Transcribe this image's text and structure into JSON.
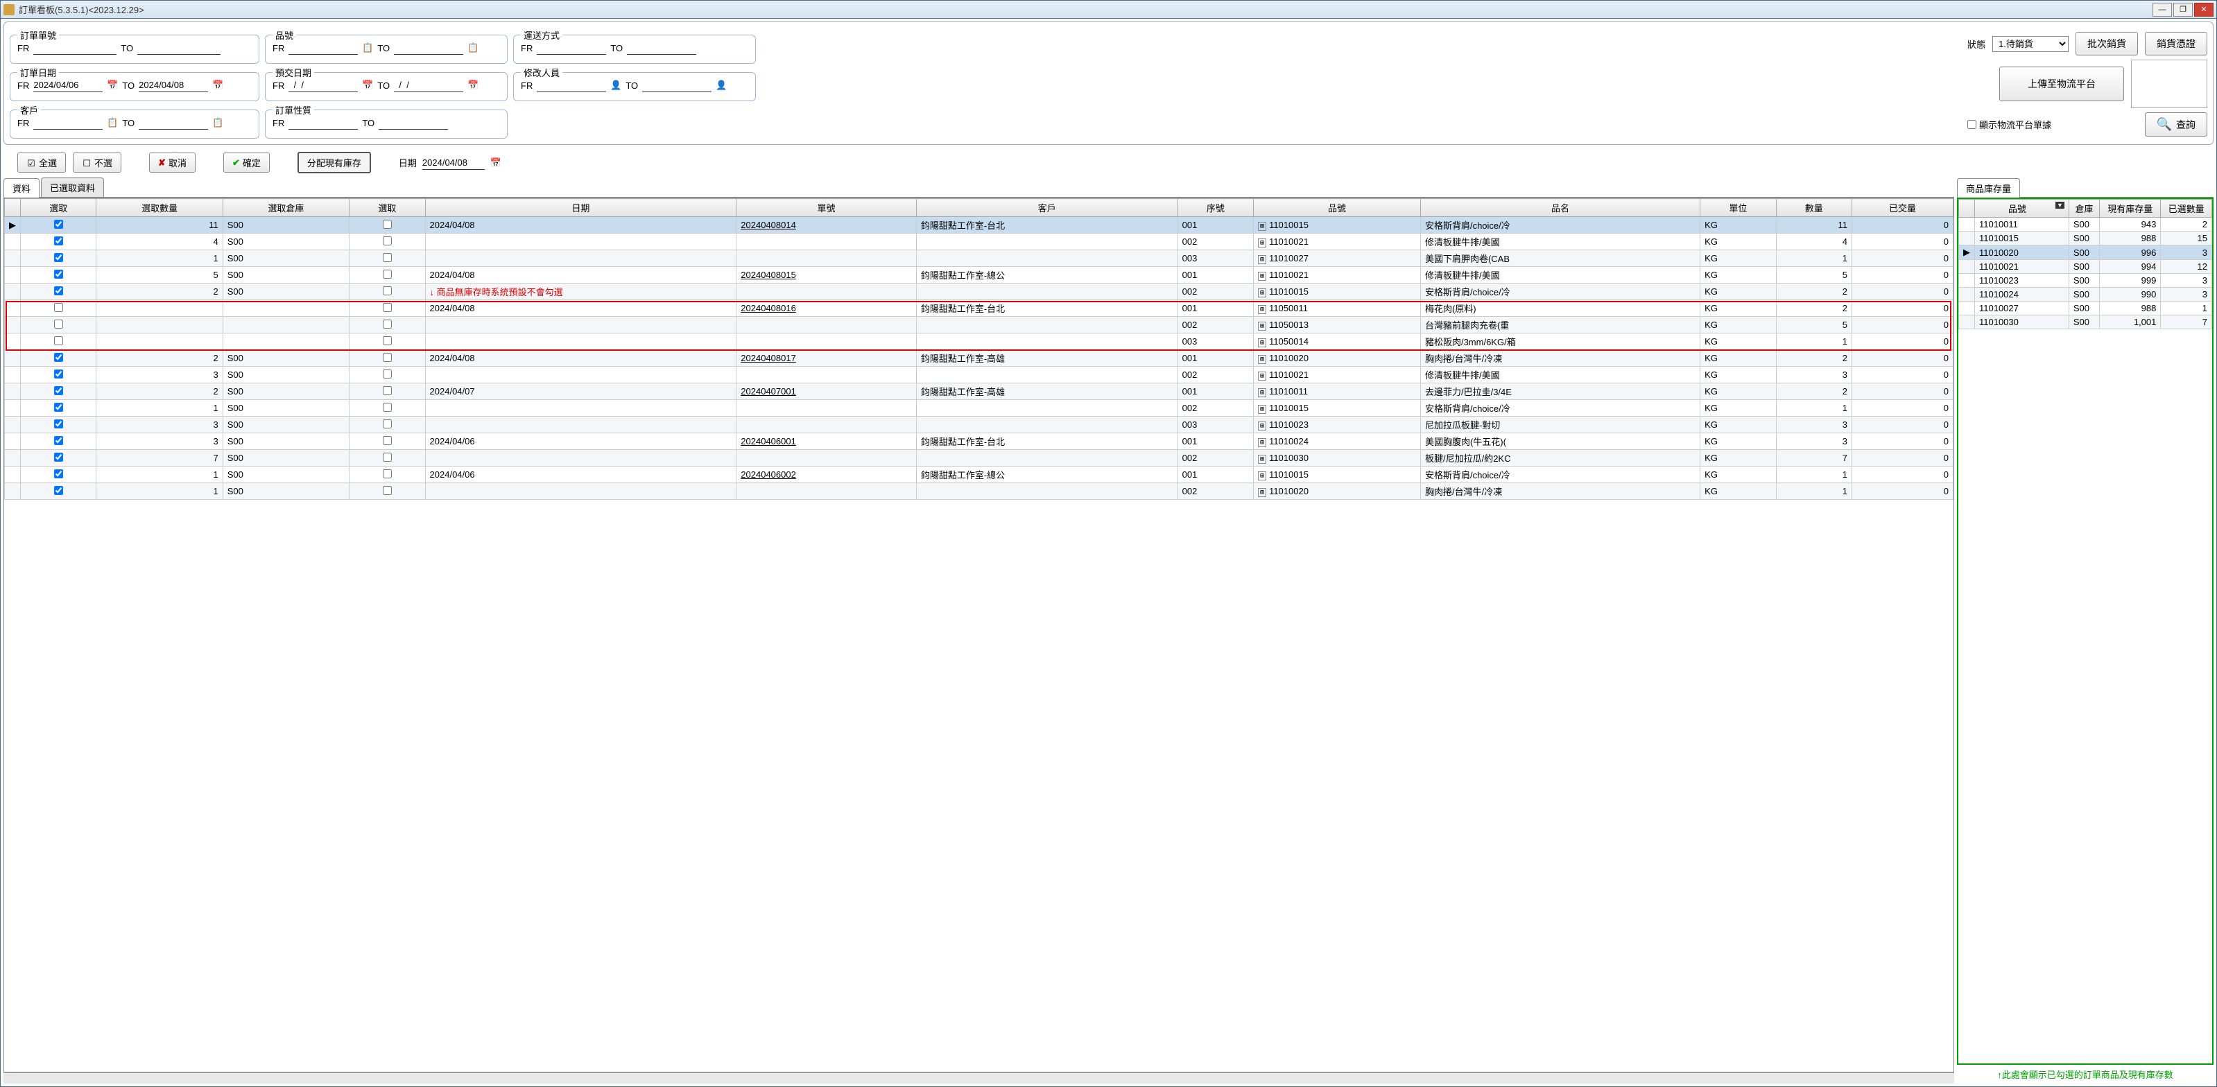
{
  "window": {
    "title": "訂單看板(5.3.5.1)<2023.12.29>"
  },
  "filters": {
    "order_no": {
      "legend": "訂單單號",
      "fr_label": "FR",
      "fr": "",
      "to_label": "TO",
      "to": ""
    },
    "product_no": {
      "legend": "品號",
      "fr_label": "FR",
      "fr": "",
      "to_label": "TO",
      "to": ""
    },
    "ship_method": {
      "legend": "運送方式",
      "fr_label": "FR",
      "fr": "",
      "to_label": "TO",
      "to": ""
    },
    "order_date": {
      "legend": "訂單日期",
      "fr_label": "FR",
      "fr": "2024/04/06",
      "to_label": "TO",
      "to": "2024/04/08"
    },
    "due_date": {
      "legend": "預交日期",
      "fr_label": "FR",
      "fr": "  /  /",
      "to_label": "TO",
      "to": "  /  /"
    },
    "modifier": {
      "legend": "修改人員",
      "fr_label": "FR",
      "fr": "",
      "to_label": "TO",
      "to": ""
    },
    "customer": {
      "legend": "客戶",
      "fr_label": "FR",
      "fr": "",
      "to_label": "TO",
      "to": ""
    },
    "order_type": {
      "legend": "訂單性質",
      "fr_label": "FR",
      "fr": "",
      "to_label": "TO",
      "to": ""
    }
  },
  "right_controls": {
    "status_label": "狀態",
    "status_value": "1.待銷貨",
    "batch_sale": "批次銷貨",
    "sale_voucher": "銷貨憑證",
    "upload_logistics": "上傳至物流平台",
    "show_logistics_label": "顯示物流平台單據",
    "search": "查詢"
  },
  "toolbar": {
    "select_all": "全選",
    "select_none": "不選",
    "cancel": "取消",
    "confirm": "確定",
    "alloc_stock": "分配現有庫存",
    "date_label": "日期",
    "date_value": "2024/04/08"
  },
  "tabs": {
    "data": "資料",
    "selected": "已選取資料"
  },
  "grid": {
    "headers": {
      "mark": "",
      "sel1": "選取",
      "sel_qty": "選取數量",
      "sel_wh": "選取倉庫",
      "sel2": "選取",
      "date": "日期",
      "doc_no": "單號",
      "customer": "客戶",
      "seq": "序號",
      "prod_no": "品號",
      "prod_name": "品名",
      "unit": "單位",
      "qty": "數量",
      "delivered": "已交量"
    },
    "rows": [
      {
        "mark": "▶",
        "sel1": true,
        "sel_qty": "11",
        "sel_wh": "S00",
        "sel2": false,
        "date": "2024/04/08",
        "doc_no": "20240408014",
        "customer": "鈞陽甜點工作室-台北",
        "seq": "001",
        "prod_no": "11010015",
        "prod_name": "安格斯背肩/choice/冷",
        "unit": "KG",
        "qty": "11",
        "delivered": "0",
        "cls": "sel"
      },
      {
        "sel1": true,
        "sel_qty": "4",
        "sel_wh": "S00",
        "sel2": false,
        "date": "",
        "doc_no": "",
        "customer": "",
        "seq": "002",
        "prod_no": "11010021",
        "prod_name": "修清板腱牛排/美國",
        "unit": "KG",
        "qty": "4",
        "delivered": "0"
      },
      {
        "sel1": true,
        "sel_qty": "1",
        "sel_wh": "S00",
        "sel2": false,
        "date": "",
        "doc_no": "",
        "customer": "",
        "seq": "003",
        "prod_no": "11010027",
        "prod_name": "美國下肩胛肉卷(CAB",
        "unit": "KG",
        "qty": "1",
        "delivered": "0",
        "cls": "even"
      },
      {
        "sel1": true,
        "sel_qty": "5",
        "sel_wh": "S00",
        "sel2": false,
        "date": "2024/04/08",
        "doc_no": "20240408015",
        "customer": "鈞陽甜點工作室-總公",
        "seq": "001",
        "prod_no": "11010021",
        "prod_name": "修清板腱牛排/美國",
        "unit": "KG",
        "qty": "5",
        "delivered": "0"
      },
      {
        "sel1": true,
        "sel_qty": "2",
        "sel_wh": "S00",
        "sel2": false,
        "date": "",
        "doc_no": "",
        "customer": "",
        "seq": "002",
        "prod_no": "11010015",
        "prod_name": "安格斯背肩/choice/冷",
        "unit": "KG",
        "qty": "2",
        "delivered": "0",
        "cls": "even",
        "note": "↓ 商品無庫存時系統預設不會勾選"
      },
      {
        "sel1": false,
        "sel_qty": "",
        "sel_wh": "",
        "sel2": false,
        "date": "2024/04/08",
        "doc_no": "20240408016",
        "customer": "鈞陽甜點工作室-台北",
        "seq": "001",
        "prod_no": "11050011",
        "prod_name": "梅花肉(原料)",
        "unit": "KG",
        "qty": "2",
        "delivered": "0",
        "redbox": "start"
      },
      {
        "sel1": false,
        "sel_qty": "",
        "sel_wh": "",
        "sel2": false,
        "date": "",
        "doc_no": "",
        "customer": "",
        "seq": "002",
        "prod_no": "11050013",
        "prod_name": "台灣豬前腿肉充卷(重",
        "unit": "KG",
        "qty": "5",
        "delivered": "0",
        "cls": "even"
      },
      {
        "sel1": false,
        "sel_qty": "",
        "sel_wh": "",
        "sel2": false,
        "date": "",
        "doc_no": "",
        "customer": "",
        "seq": "003",
        "prod_no": "11050014",
        "prod_name": "豬松阪肉/3mm/6KG/箱",
        "unit": "KG",
        "qty": "1",
        "delivered": "0",
        "redbox": "end"
      },
      {
        "sel1": true,
        "sel_qty": "2",
        "sel_wh": "S00",
        "sel2": false,
        "date": "2024/04/08",
        "doc_no": "20240408017",
        "customer": "鈞陽甜點工作室-高雄",
        "seq": "001",
        "prod_no": "11010020",
        "prod_name": "胸肉捲/台灣牛/冷凍",
        "unit": "KG",
        "qty": "2",
        "delivered": "0",
        "cls": "even"
      },
      {
        "sel1": true,
        "sel_qty": "3",
        "sel_wh": "S00",
        "sel2": false,
        "date": "",
        "doc_no": "",
        "customer": "",
        "seq": "002",
        "prod_no": "11010021",
        "prod_name": "修清板腱牛排/美國",
        "unit": "KG",
        "qty": "3",
        "delivered": "0"
      },
      {
        "sel1": true,
        "sel_qty": "2",
        "sel_wh": "S00",
        "sel2": false,
        "date": "2024/04/07",
        "doc_no": "20240407001",
        "customer": "鈞陽甜點工作室-高雄",
        "seq": "001",
        "prod_no": "11010011",
        "prod_name": "去邊菲力/巴拉圭/3/4E",
        "unit": "KG",
        "qty": "2",
        "delivered": "0",
        "cls": "even"
      },
      {
        "sel1": true,
        "sel_qty": "1",
        "sel_wh": "S00",
        "sel2": false,
        "date": "",
        "doc_no": "",
        "customer": "",
        "seq": "002",
        "prod_no": "11010015",
        "prod_name": "安格斯背肩/choice/冷",
        "unit": "KG",
        "qty": "1",
        "delivered": "0"
      },
      {
        "sel1": true,
        "sel_qty": "3",
        "sel_wh": "S00",
        "sel2": false,
        "date": "",
        "doc_no": "",
        "customer": "",
        "seq": "003",
        "prod_no": "11010023",
        "prod_name": "尼加拉瓜板腱-對切",
        "unit": "KG",
        "qty": "3",
        "delivered": "0",
        "cls": "even"
      },
      {
        "sel1": true,
        "sel_qty": "3",
        "sel_wh": "S00",
        "sel2": false,
        "date": "2024/04/06",
        "doc_no": "20240406001",
        "customer": "鈞陽甜點工作室-台北",
        "seq": "001",
        "prod_no": "11010024",
        "prod_name": "美國胸腹肉(牛五花)(",
        "unit": "KG",
        "qty": "3",
        "delivered": "0"
      },
      {
        "sel1": true,
        "sel_qty": "7",
        "sel_wh": "S00",
        "sel2": false,
        "date": "",
        "doc_no": "",
        "customer": "",
        "seq": "002",
        "prod_no": "11010030",
        "prod_name": "板腱/尼加拉瓜/約2KC",
        "unit": "KG",
        "qty": "7",
        "delivered": "0",
        "cls": "even"
      },
      {
        "sel1": true,
        "sel_qty": "1",
        "sel_wh": "S00",
        "sel2": false,
        "date": "2024/04/06",
        "doc_no": "20240406002",
        "customer": "鈞陽甜點工作室-總公",
        "seq": "001",
        "prod_no": "11010015",
        "prod_name": "安格斯背肩/choice/冷",
        "unit": "KG",
        "qty": "1",
        "delivered": "0"
      },
      {
        "sel1": true,
        "sel_qty": "1",
        "sel_wh": "S00",
        "sel2": false,
        "date": "",
        "doc_no": "",
        "customer": "",
        "seq": "002",
        "prod_no": "11010020",
        "prod_name": "胸肉捲/台灣牛/冷凍",
        "unit": "KG",
        "qty": "1",
        "delivered": "0",
        "cls": "even"
      }
    ]
  },
  "stock_panel": {
    "title": "商品庫存量",
    "headers": {
      "prod_no": "品號",
      "wh": "倉庫",
      "onhand": "現有庫存量",
      "selected_qty": "已選數量"
    },
    "rows": [
      {
        "prod_no": "11010011",
        "wh": "S00",
        "onhand": "943",
        "sel": "2"
      },
      {
        "prod_no": "11010015",
        "wh": "S00",
        "onhand": "988",
        "sel": "15",
        "cls": "even"
      },
      {
        "prod_no": "11010020",
        "wh": "S00",
        "onhand": "996",
        "sel": "3",
        "cls": "stock-sel",
        "mark": "▶"
      },
      {
        "prod_no": "11010021",
        "wh": "S00",
        "onhand": "994",
        "sel": "12",
        "cls": "even"
      },
      {
        "prod_no": "11010023",
        "wh": "S00",
        "onhand": "999",
        "sel": "3"
      },
      {
        "prod_no": "11010024",
        "wh": "S00",
        "onhand": "990",
        "sel": "3",
        "cls": "even"
      },
      {
        "prod_no": "11010027",
        "wh": "S00",
        "onhand": "988",
        "sel": "1"
      },
      {
        "prod_no": "11010030",
        "wh": "S00",
        "onhand": "1,001",
        "sel": "7",
        "cls": "even"
      }
    ],
    "note": "↑此處會顯示已勾選的訂單商品及現有庫存數"
  }
}
